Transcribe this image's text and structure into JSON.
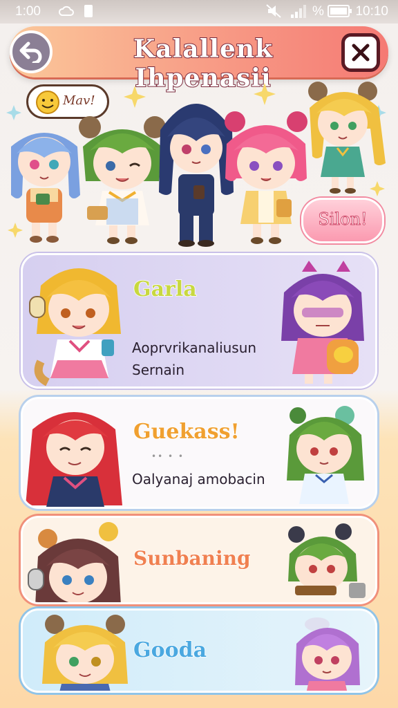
{
  "status_bar": {
    "time_left": "1:00",
    "time_right": "10:10",
    "battery_label": "%"
  },
  "header": {
    "title": "Kalallenk Ihpenasii",
    "back_icon": "back-arrow-icon",
    "close_icon": "close-icon"
  },
  "hero": {
    "bubble_text": "Mav!",
    "select_button": "Silon!"
  },
  "cards": [
    {
      "name": "Garla",
      "name_color": "#c8d840",
      "desc1": "Aoprvrikanaliusun",
      "desc2": "Sernain",
      "bg": "#dcd6f2"
    },
    {
      "name": "Guekass!",
      "name_color": "#f0a030",
      "faint": "•• • •",
      "desc1": "Oalyanaj amobacin",
      "bg": "#fbf9fb"
    },
    {
      "name": "Sunbaning",
      "name_color": "#f08050",
      "bg": "#fdf3e8"
    },
    {
      "name": "Gooda",
      "name_color": "#4aa8e0",
      "bg": "#dff0fa"
    }
  ],
  "colors": {
    "header_start": "#fbc89a",
    "header_end": "#f57a74",
    "accent_pink": "#fb9ab0"
  }
}
